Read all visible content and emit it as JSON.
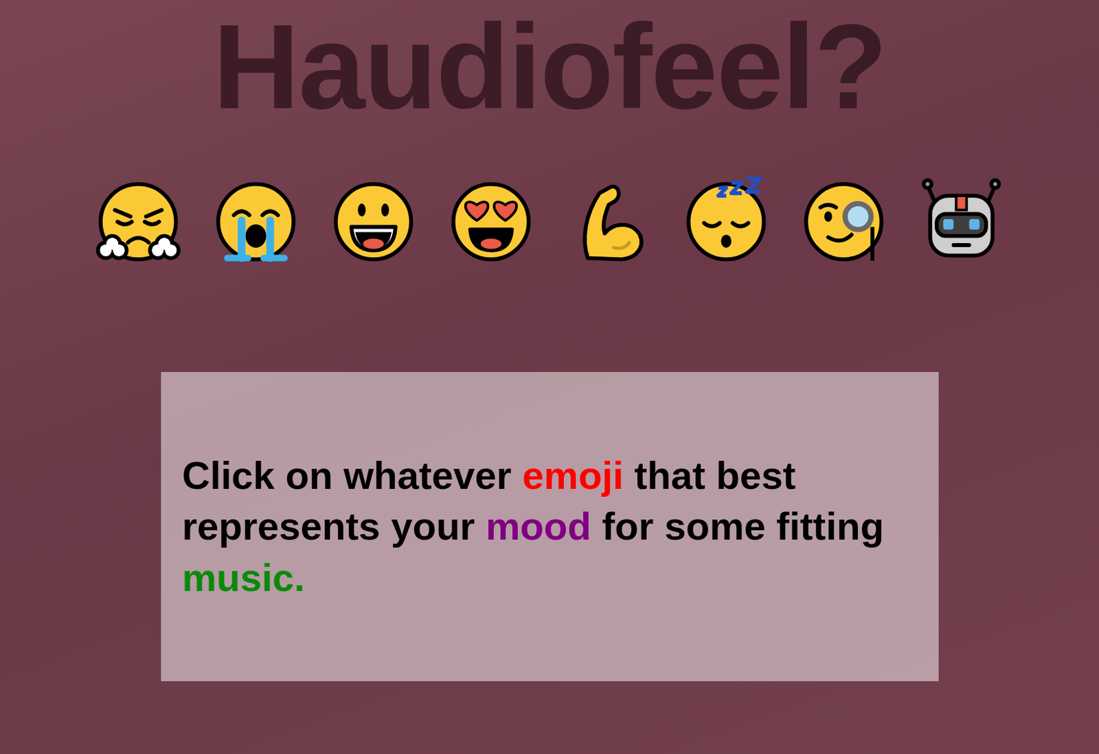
{
  "title": "Haudiofeel?",
  "emojis": [
    {
      "kind": "angry"
    },
    {
      "kind": "crying"
    },
    {
      "kind": "smile"
    },
    {
      "kind": "hearteyes"
    },
    {
      "kind": "bicep"
    },
    {
      "kind": "sleeping"
    },
    {
      "kind": "monocle"
    },
    {
      "kind": "robot"
    }
  ],
  "instructions": [
    {
      "text": "Click on whatever",
      "color": "#000000"
    },
    {
      "text": "emoji",
      "color": "#ff0000"
    },
    {
      "text": "that best represents your",
      "color": "#000000"
    },
    {
      "text": "mood",
      "color": "#800080"
    },
    {
      "text": "for some fitting",
      "color": "#000000"
    },
    {
      "text": "music.",
      "color": "#0a8a0a"
    }
  ]
}
